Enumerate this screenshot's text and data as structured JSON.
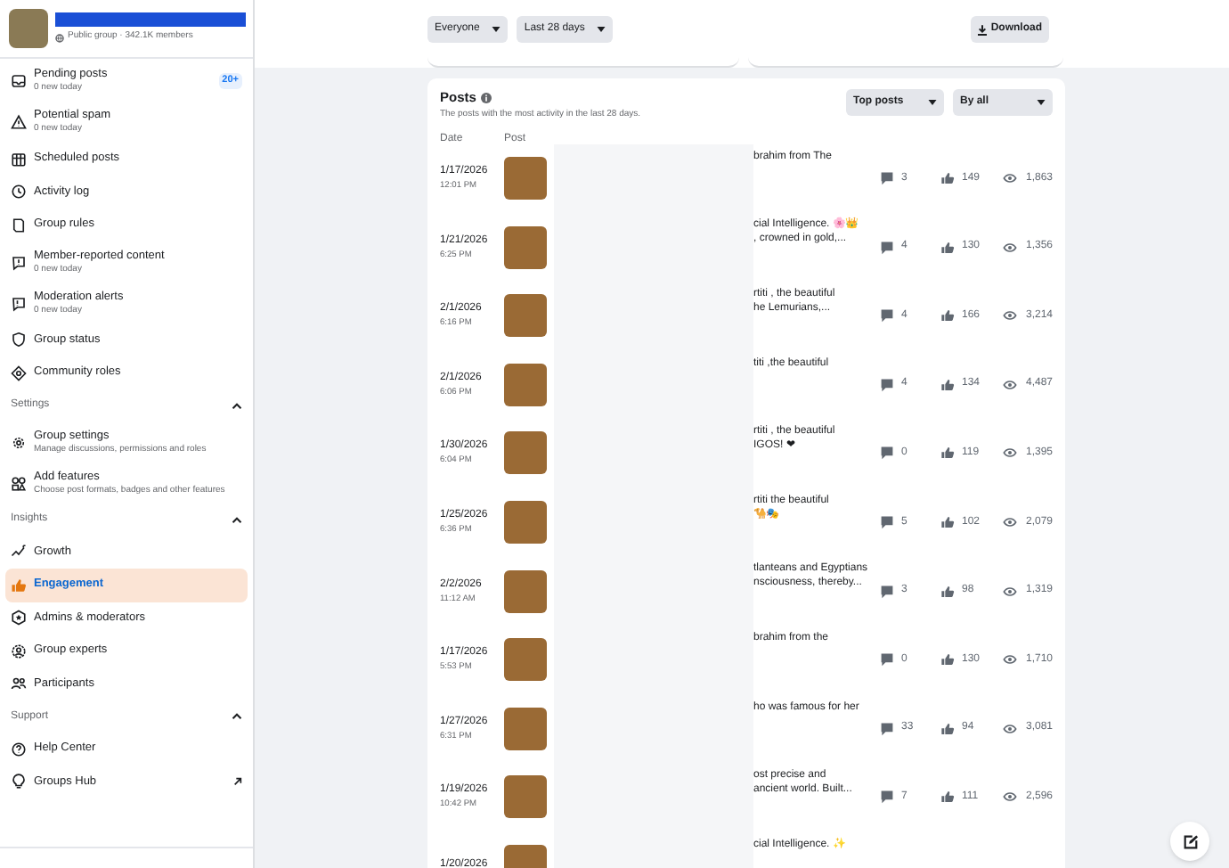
{
  "group": {
    "subtitle": "Public group · 342.1K members"
  },
  "sidebar": [
    {
      "kind": "item",
      "label": "Pending posts",
      "sub": "0 new today",
      "badge": "20+",
      "selected": false
    },
    {
      "kind": "item",
      "label": "Potential spam",
      "sub": "0 new today",
      "selected": false
    },
    {
      "kind": "item",
      "label": "Scheduled posts",
      "selected": false
    },
    {
      "kind": "item",
      "label": "Activity log",
      "selected": false
    },
    {
      "kind": "item",
      "label": "Group rules",
      "selected": false
    },
    {
      "kind": "item",
      "label": "Member-reported content",
      "sub": "0 new today",
      "selected": false
    },
    {
      "kind": "item",
      "label": "Moderation alerts",
      "sub": "0 new today",
      "selected": false
    },
    {
      "kind": "item",
      "label": "Group status",
      "selected": false
    },
    {
      "kind": "item",
      "label": "Community roles",
      "selected": false
    },
    {
      "kind": "section",
      "label": "Settings",
      "expanded": true
    },
    {
      "kind": "item",
      "label": "Group settings",
      "sub": "Manage discussions, permissions and roles",
      "selected": false
    },
    {
      "kind": "item",
      "label": "Add features",
      "sub": "Choose post formats, badges and other features",
      "selected": false
    },
    {
      "kind": "section",
      "label": "Insights",
      "expanded": true
    },
    {
      "kind": "item",
      "label": "Growth",
      "selected": false
    },
    {
      "kind": "item",
      "label": "Engagement",
      "selected": true
    },
    {
      "kind": "item",
      "label": "Admins & moderators",
      "selected": false
    },
    {
      "kind": "item",
      "label": "Group experts",
      "selected": false
    },
    {
      "kind": "item",
      "label": "Participants",
      "selected": false
    },
    {
      "kind": "section",
      "label": "Support",
      "expanded": true
    },
    {
      "kind": "item",
      "label": "Help Center",
      "selected": false
    },
    {
      "kind": "item",
      "label": "Groups Hub",
      "external": true,
      "selected": false
    }
  ],
  "filters": [
    "Everyone",
    "Last 28 days"
  ],
  "download": "Download",
  "posts": {
    "title": "Posts",
    "subtitle": "The posts with the most activity in the last 28 days.",
    "sort": [
      "Top posts",
      "By all"
    ],
    "columns": [
      "Date",
      "Post"
    ],
    "rows": [
      {
        "date": "1/17/2026",
        "time": "12:01 PM",
        "text": [
          "brahim from The"
        ],
        "comments": "3",
        "likes": "149",
        "views": "1,863"
      },
      {
        "date": "1/21/2026",
        "time": "6:25 PM",
        "text": [
          "cial Intelligence. 🌸👑",
          ", crowned in gold,..."
        ],
        "comments": "4",
        "likes": "130",
        "views": "1,356"
      },
      {
        "date": "2/1/2026",
        "time": "6:16 PM",
        "text": [
          "rtiti , the beautiful",
          "he Lemurians,..."
        ],
        "comments": "4",
        "likes": "166",
        "views": "3,214"
      },
      {
        "date": "2/1/2026",
        "time": "6:06 PM",
        "text": [
          "titi ,the beautiful"
        ],
        "comments": "4",
        "likes": "134",
        "views": "4,487"
      },
      {
        "date": "1/30/2026",
        "time": "6:04 PM",
        "text": [
          "rtiti , the beautiful",
          "IGOS! ❤"
        ],
        "comments": "0",
        "likes": "119",
        "views": "1,395"
      },
      {
        "date": "1/25/2026",
        "time": "6:36 PM",
        "text": [
          "rtiti the beautiful",
          "🐪🎭"
        ],
        "comments": "5",
        "likes": "102",
        "views": "2,079"
      },
      {
        "date": "2/2/2026",
        "time": "11:12 AM",
        "text": [
          "tlanteans and Egyptians",
          "nsciousness, thereby..."
        ],
        "comments": "3",
        "likes": "98",
        "views": "1,319"
      },
      {
        "date": "1/17/2026",
        "time": "5:53 PM",
        "text": [
          "brahim from the"
        ],
        "comments": "0",
        "likes": "130",
        "views": "1,710"
      },
      {
        "date": "1/27/2026",
        "time": "6:31 PM",
        "text": [
          "ho was famous for her"
        ],
        "comments": "33",
        "likes": "94",
        "views": "3,081"
      },
      {
        "date": "1/19/2026",
        "time": "10:42 PM",
        "text": [
          "ost precise and",
          "ancient world. Built..."
        ],
        "comments": "7",
        "likes": "111",
        "views": "2,596"
      },
      {
        "date": "1/20/2026",
        "time": "",
        "text": [
          "cial Intelligence. ✨"
        ],
        "comments": "",
        "likes": "",
        "views": ""
      }
    ]
  }
}
